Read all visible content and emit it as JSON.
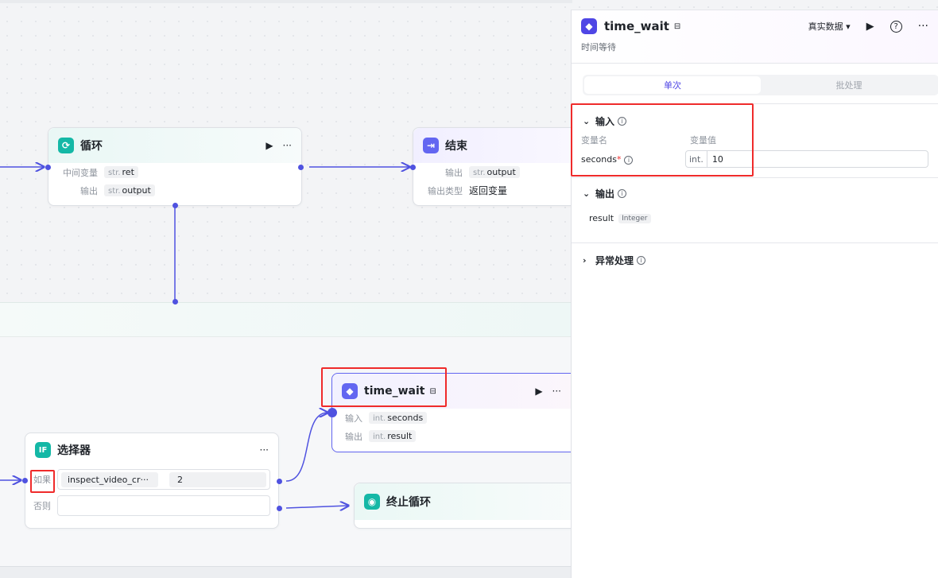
{
  "colors": {
    "accent": "#4f46e5",
    "edge": "#4f52e0",
    "highlight": "#ef2b2b",
    "teal": "#14b8a6"
  },
  "canvas": {
    "loop_node": {
      "title": "循环",
      "icon": "loop-icon",
      "rows": [
        {
          "label": "中间变量",
          "type": "str.",
          "value": "ret"
        },
        {
          "label": "输出",
          "type": "str.",
          "value": "output"
        }
      ]
    },
    "end_node": {
      "title": "结束",
      "icon": "end-icon",
      "rows": [
        {
          "label": "输出",
          "type": "str.",
          "value": "output"
        },
        {
          "label": "输出类型",
          "value": "返回变量"
        }
      ]
    },
    "time_wait_node": {
      "title": "time_wait",
      "icon": "cube-icon",
      "rows": [
        {
          "label": "输入",
          "type": "int.",
          "value": "seconds"
        },
        {
          "label": "输出",
          "type": "int.",
          "value": "result"
        }
      ]
    },
    "selector_node": {
      "title": "选择器",
      "icon_text": "IF",
      "if_label": "如果",
      "else_label": "否则",
      "if_left": "inspect_video_cr···",
      "if_right": "2"
    },
    "stop_loop_node": {
      "title": "终止循环",
      "icon": "stop-icon"
    },
    "more_label": "···"
  },
  "panel": {
    "title": "time_wait",
    "subtitle": "时间等待",
    "data_mode": "真实数据 ▾",
    "tabs": [
      "单次",
      "批处理"
    ],
    "input_section": {
      "title": "输入",
      "col_name": "变量名",
      "col_value": "变量值",
      "var_name": "seconds",
      "required_mark": "*",
      "var_type": "int.",
      "var_value": "10"
    },
    "output_section": {
      "title": "输出",
      "var_name": "result",
      "var_type": "Integer"
    },
    "exception_section": {
      "title": "异常处理"
    }
  }
}
